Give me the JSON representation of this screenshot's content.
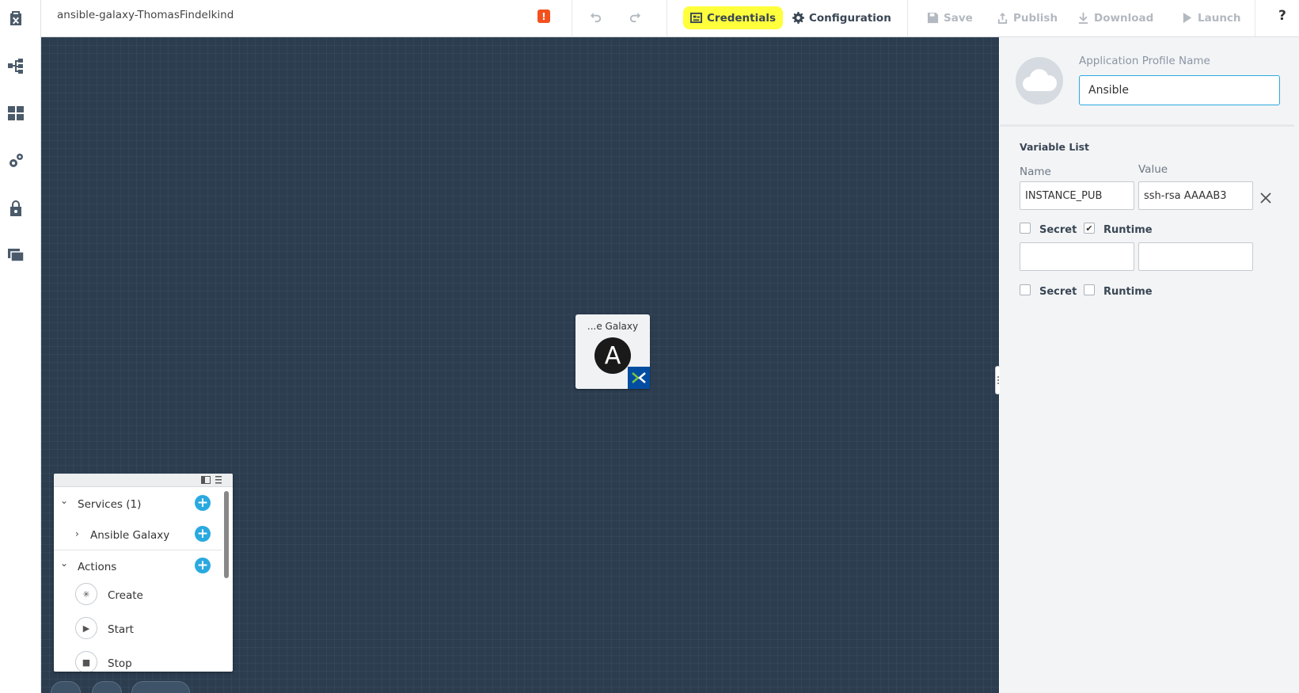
{
  "rail": {
    "items": [
      "blueprint-icon",
      "hierarchy-icon",
      "apps-grid-icon",
      "settings-gears-icon",
      "lock-icon",
      "gallery-icon"
    ]
  },
  "topbar": {
    "title": "ansible-galaxy-ThomasFindelkind",
    "alert": "!",
    "credentials_label": "Credentials",
    "configuration_label": "Configuration",
    "save_label": "Save",
    "publish_label": "Publish",
    "download_label": "Download",
    "launch_label": "Launch",
    "help_label": "?",
    "highlight_color": "#ffff3c"
  },
  "canvas": {
    "node": {
      "label": "...e Galaxy",
      "logo_letter": "A"
    }
  },
  "panel": {
    "profile_name_label": "Application Profile Name",
    "profile_name_value": "Ansible",
    "variable_list_title": "Variable List",
    "col_name": "Name",
    "col_value": "Value",
    "variables": [
      {
        "name": "INSTANCE_PUB",
        "value": "ssh-rsa AAAAB3",
        "secret": false,
        "runtime": true
      },
      {
        "name": "",
        "value": "",
        "secret": false,
        "runtime": false
      }
    ],
    "secret_label": "Secret",
    "runtime_label": "Runtime"
  },
  "tree": {
    "services_label": "Services (1)",
    "service_item": "Ansible Galaxy",
    "actions_label": "Actions",
    "actions": [
      "Create",
      "Start",
      "Stop"
    ]
  },
  "colors": {
    "canvas_bg": "#2c3d50",
    "accent": "#2aa9e0",
    "nutanix_badge": "#024da1"
  }
}
